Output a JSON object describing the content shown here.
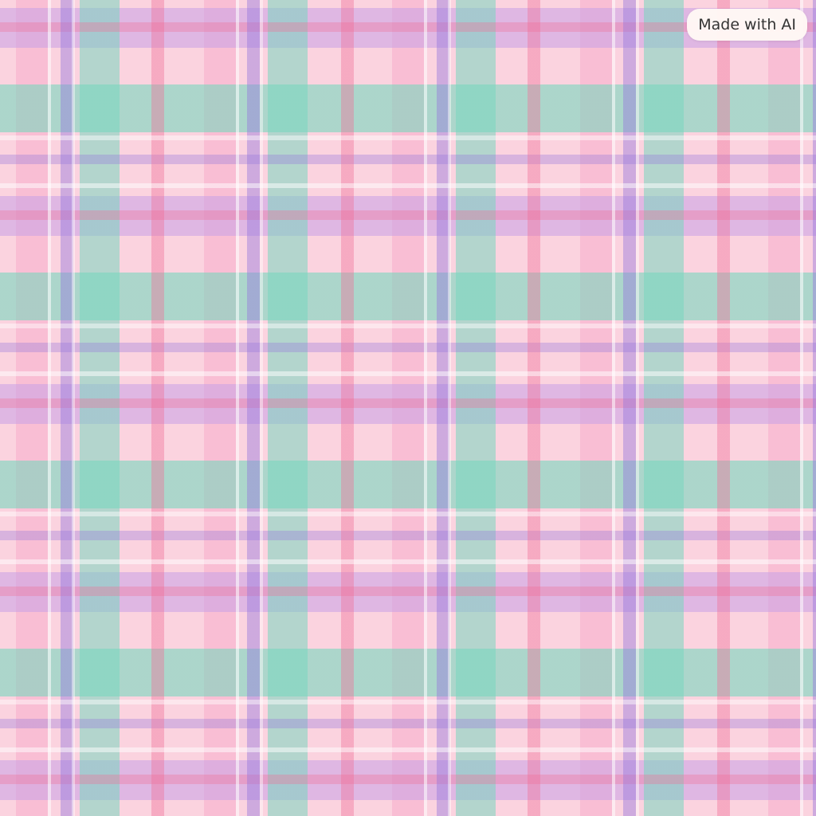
{
  "background": {
    "pattern": "plaid",
    "colors": {
      "pink": "#fbd3df",
      "mint": "#78d7be",
      "lavender": "#c8a0e6",
      "violet": "#9678dc",
      "rose": "#f06e96"
    }
  },
  "badge": {
    "label": "Made with AI"
  }
}
